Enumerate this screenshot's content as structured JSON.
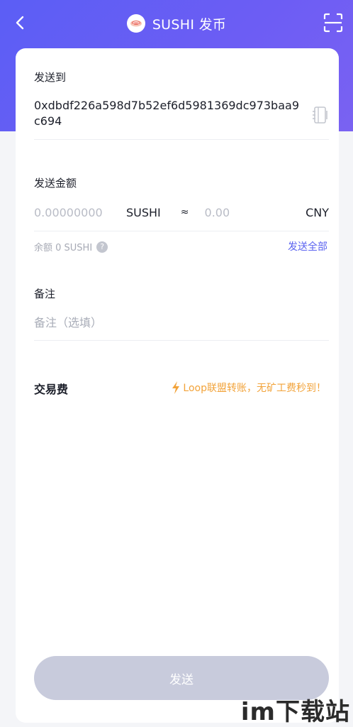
{
  "header": {
    "title": "SUSHI 发币"
  },
  "form": {
    "to_label": "发送到",
    "to_address": "0xdbdf226a598d7b52ef6d5981369dc973baa9c694",
    "amount_label": "发送金额",
    "amount_placeholder": "0.00000000",
    "amount_unit": "SUSHI",
    "approx_symbol": "≈",
    "cny_placeholder": "0.00",
    "cny_unit": "CNY",
    "balance_text": "余额 0 SUSHI",
    "help_glyph": "?",
    "send_all_label": "发送全部",
    "memo_label": "备注",
    "memo_placeholder": "备注（选填）",
    "fee_label": "交易费",
    "fee_promo": "Loop联盟转账，无矿工费秒到！",
    "send_button_label": "发送"
  },
  "watermark": "im下载站",
  "colors": {
    "header_gradient_start": "#5b5ef5",
    "header_gradient_end": "#7a62f2",
    "accent": "#5b63f0",
    "promo": "#f2a33a",
    "button_disabled": "#c8cbdc"
  },
  "icons": {
    "back": "chevron-left-icon",
    "scan": "scan-icon",
    "coin": "sushi-coin-icon",
    "address_book": "address-book-icon",
    "help": "question-circle-icon",
    "lightning": "lightning-icon"
  }
}
